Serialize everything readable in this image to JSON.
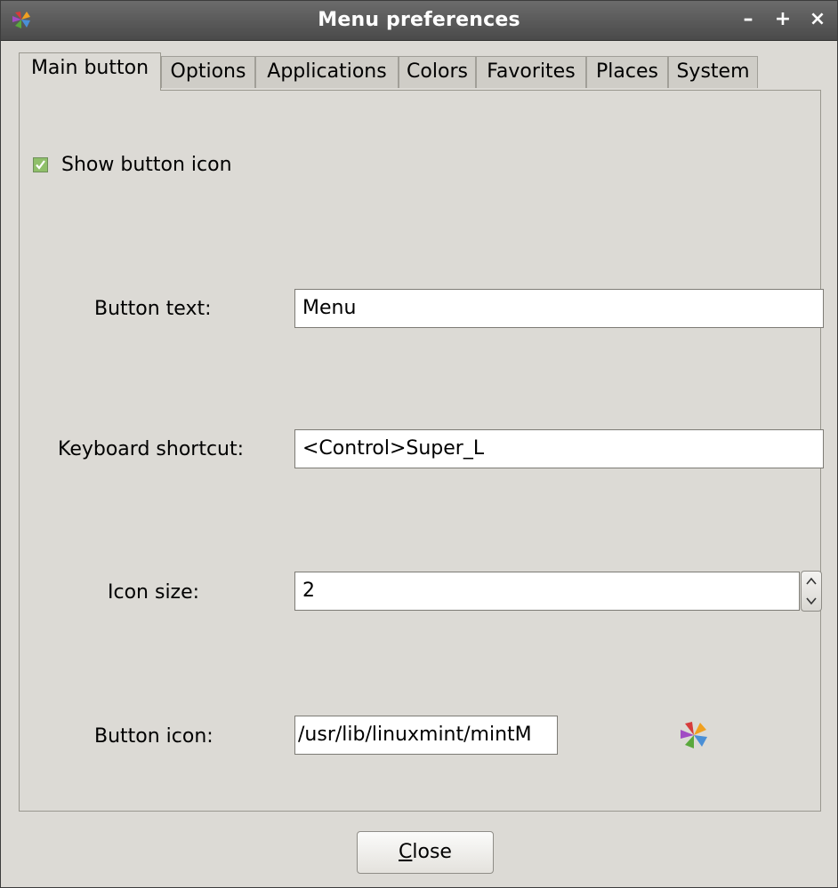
{
  "window": {
    "title": "Menu preferences",
    "minimize_glyph": "–",
    "maximize_glyph": "+",
    "close_glyph": "×",
    "app_icon": "mint-menu-icon"
  },
  "tabs": [
    {
      "label": "Main button",
      "active": true
    },
    {
      "label": "Options",
      "active": false
    },
    {
      "label": "Applications",
      "active": false
    },
    {
      "label": "Colors",
      "active": false
    },
    {
      "label": "Favorites",
      "active": false
    },
    {
      "label": "Places",
      "active": false
    },
    {
      "label": "System",
      "active": false
    }
  ],
  "main_button": {
    "show_icon": {
      "label": "Show button icon",
      "checked": true
    },
    "button_text": {
      "label": "Button text:",
      "value": "Menu"
    },
    "keyboard_shortcut": {
      "label": "Keyboard shortcut:",
      "value": "<Control>Super_L"
    },
    "icon_size": {
      "label": "Icon size:",
      "value": "2"
    },
    "button_icon": {
      "label": "Button icon:",
      "value": "/usr/lib/linuxmint/mintM",
      "preview_icon": "mint-menu-icon"
    }
  },
  "footer": {
    "close_mnemonic": "C",
    "close_rest": "lose"
  },
  "colors": {
    "titlebar": "#555555",
    "background": "#dcdad5",
    "checkbox_check": "#4e9a06"
  }
}
